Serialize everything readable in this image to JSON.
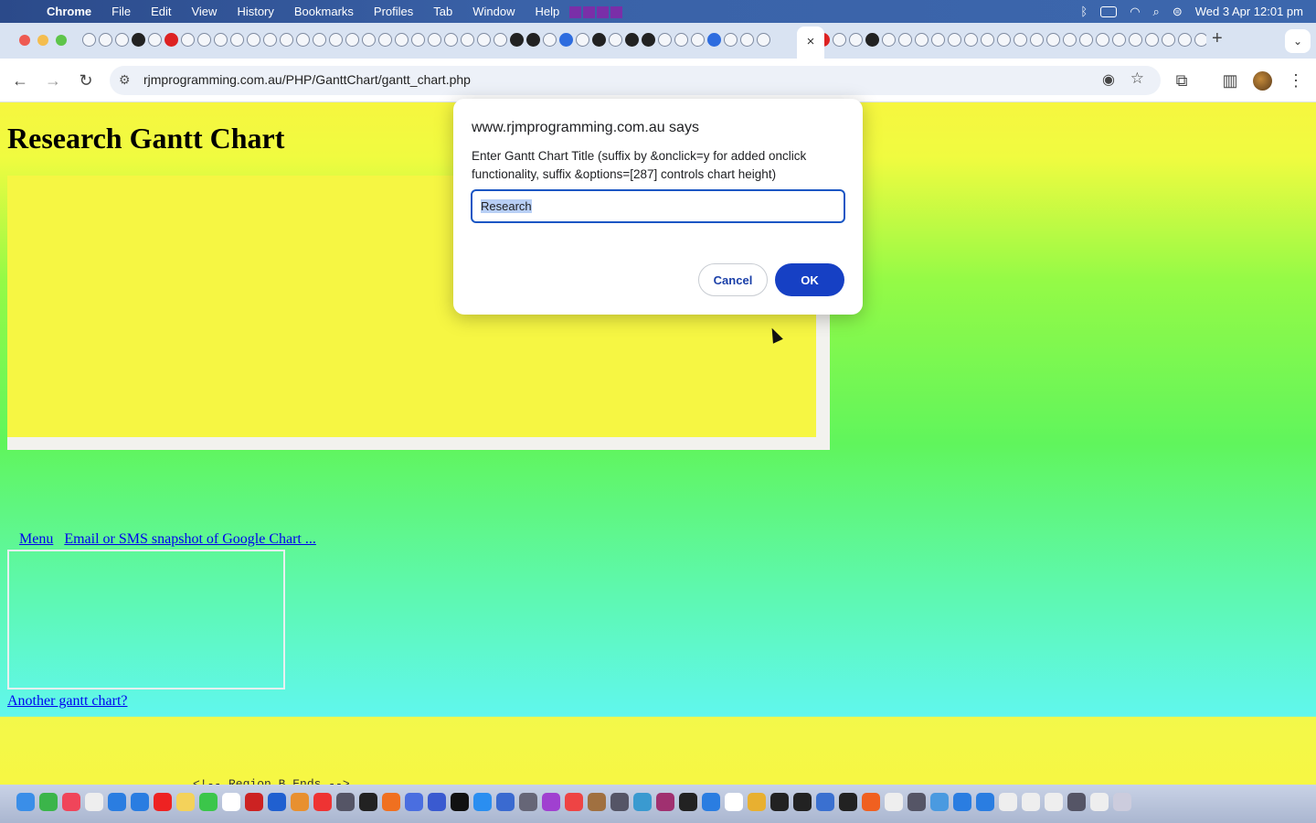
{
  "menubar": {
    "app": "Chrome",
    "items": [
      "File",
      "Edit",
      "View",
      "History",
      "Bookmarks",
      "Profiles",
      "Tab",
      "Window",
      "Help"
    ],
    "datetime": "Wed 3 Apr  12:01 pm"
  },
  "browser": {
    "url": "rjmprogramming.com.au/PHP/GanttChart/gantt_chart.php",
    "close_tab_glyph": "×",
    "new_tab_glyph": "+"
  },
  "page": {
    "heading": "Research Gantt Chart",
    "links": [
      "Menu",
      "Email or SMS snapshot of Google Chart ..."
    ],
    "another_link": "Another gantt chart?",
    "bottom_text": "<!-- Region B Ends -->"
  },
  "dialog": {
    "title": "www.rjmprogramming.com.au says",
    "message": "Enter Gantt Chart Title (suffix by &onclick=y for added onclick functionality, suffix &options=[287] controls chart height)",
    "input_value": "Research",
    "cancel_label": "Cancel",
    "ok_label": "OK"
  },
  "colors": {
    "ok_button": "#1640c4",
    "page_top": "#f6f63f",
    "page_bottom": "#61f6ec"
  }
}
